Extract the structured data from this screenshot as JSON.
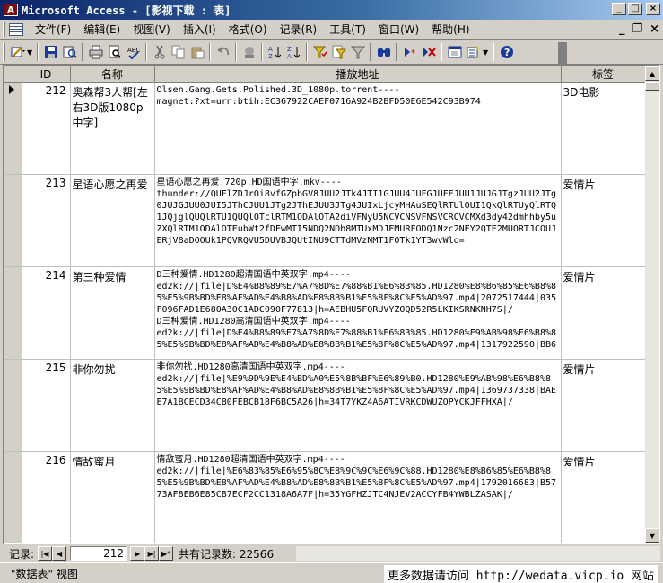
{
  "window": {
    "title": "Microsoft Access - [影视下载 : 表]",
    "app_icon": "A",
    "minimize": "_",
    "maximize": "□",
    "close": "×"
  },
  "menu": {
    "items": [
      "文件(F)",
      "编辑(E)",
      "视图(V)",
      "插入(I)",
      "格式(O)",
      "记录(R)",
      "工具(T)",
      "窗口(W)",
      "帮助(H)"
    ],
    "mdi_minimize": "_",
    "mdi_restore": "❐",
    "mdi_close": "×"
  },
  "toolbar": {
    "icons": [
      "view-design-icon",
      "save-icon",
      "search-icon",
      "print-icon",
      "print-preview-icon",
      "spelling-icon",
      "cut-icon",
      "copy-icon",
      "paste-icon",
      "undo-icon",
      "insert-object-icon",
      "sort-ascending-icon",
      "sort-descending-icon",
      "filter-by-selection-icon",
      "filter-by-form-icon",
      "apply-filter-icon",
      "find-icon",
      "new-record-icon",
      "delete-record-icon",
      "database-window-icon",
      "new-object-icon",
      "help-icon"
    ]
  },
  "table": {
    "columns": [
      "ID",
      "名称",
      "播放地址",
      "标签"
    ],
    "rows": [
      {
        "id": "212",
        "name": "奥森帮3人帮[左右3D版1080p中字]",
        "url_lines": [
          "Olsen.Gang.Gets.Polished.3D_1080p.torrent----",
          "magnet:?xt=urn:btih:EC367922CAEF0716A924B2BFD50E6E542C93B974"
        ],
        "tag": "3D电影"
      },
      {
        "id": "213",
        "name": "星语心愿之再爱",
        "url_lines": [
          "星语心愿之再爱.720p.HD国语中字.mkv----",
          "thunder://QUFlZDJrOi8vfGZpbGV8JUU2JTk4JTI1GJUU4JUFGJUFEJUU1JUJGJTgzJUU2JTg0JUJGJUU0JUI5JThCJUU1JTg2JThEJUU3JTg4JUIxLjcyMHAuSEQlRTUlOUI1QkQlRTUyQlRTQ1JQjglQUQlRTU1QUQlOTclRTM1ODAlOTA2diVFNyU5NCVCNSVFNSVCRCVCMXd3dy42dmhhby5uZXQlRTM1ODAlOTEubWt2fDEwMTI5NDQ2NDh8MTUxMDJEMURFODQ1Nzc2NEY2QTE2MUORTJCOUJERjV8aDOOUk1PQVRQVU5DUVBJQUtINU9CTTdMVzNMT1FOTk1YT3wvWlo="
        ],
        "tag": "爱情片"
      },
      {
        "id": "214",
        "name": "第三种爱情",
        "url_lines": [
          "D三种爱情.HD1280超清国语中英双字.mp4----",
          "ed2k://|file|D%E4%B8%89%E7%A7%8D%E7%88%B1%E6%83%85.HD1280%E8%B6%85%E6%B8%85%E5%9B%BD%E8%AF%AD%E4%B8%AD%E8%8B%B1%E5%8F%8C%E5%AD%97.mp4|2072517444|035F096FAD1E680A30C1ADC090F77813|h=AEBHU5FQRUVYZOQD52R5LKIKSRNKNH7S|/",
          "D三种爱情.HD1280高清国语中英双字.mp4----",
          "ed2k://|file|D%E4%B8%89%E7%A7%8D%E7%88%B1%E6%83%85.HD1280%E9%AB%98%E6%B8%85%E5%9B%BD%E8%AF%AD%E4%B8%AD%E8%8B%B1%E5%8F%8C%E5%AD%97.mp4|1317922590|BB6"
        ],
        "tag": "爱情片"
      },
      {
        "id": "215",
        "name": "非你勿扰",
        "url_lines": [
          "非你勿扰.HD1280高清国语中英双字.mp4----",
          "ed2k://|file|%E9%9D%9E%E4%BD%A0%E5%8B%BF%E6%89%B0.HD1280%E9%AB%98%E6%B8%85%E5%9B%BD%E8%AF%AD%E4%B8%AD%E8%8B%B1%E5%8F%8C%E5%AD%97.mp4|1369737338|BAEE7A1BCECD34CB0FEBCB18F6BC5A26|h=34T7YKZ4A6ATIVRKCDWUZOPYCKJFFHXA|/"
        ],
        "tag": "爱情片"
      },
      {
        "id": "216",
        "name": "情敌蜜月",
        "url_lines": [
          "情敌蜜月.HD1280超清国语中英双字.mp4----",
          "ed2k://|file|%E6%83%85%E6%95%8C%E8%9C%9C%E6%9C%88.HD1280%E8%B6%85%E6%B8%85%E5%9B%BD%E8%AF%AD%E4%B8%AD%E8%8B%B1%E5%8F%8C%E5%AD%97.mp4|1792016683|B5773AF8EB6E85CB7ECF2CC1318A6A7F|h=35YGFHZJTC4NJEV2ACCYFB4YWBLZASAK|/"
        ],
        "tag": "爱情片"
      }
    ]
  },
  "navigation": {
    "label": "记录:",
    "first": "|◀",
    "prev": "◀",
    "current": "212",
    "next": "▶",
    "last": "▶|",
    "new": "▶*",
    "total_text": "共有记录数: 22566"
  },
  "status": {
    "view": "\"数据表\" 视图",
    "watermark": "更多数据请访问 http://wedata.vicp.io 网站"
  }
}
